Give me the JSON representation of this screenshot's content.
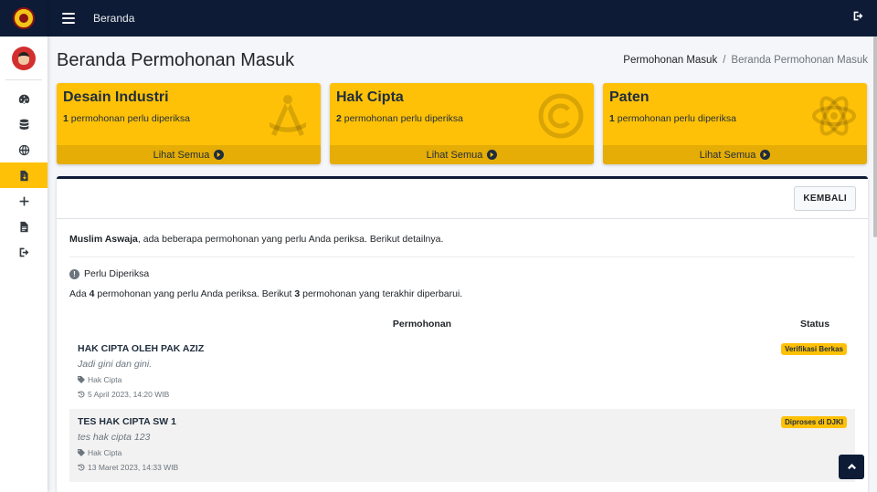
{
  "topbar": {
    "link_label": "Beranda"
  },
  "sidebar": {
    "items": [
      {
        "icon": "dashboard-icon"
      },
      {
        "icon": "database-icon"
      },
      {
        "icon": "globe-icon"
      },
      {
        "icon": "file-download-icon",
        "active": true
      },
      {
        "icon": "plus-icon"
      },
      {
        "icon": "file-icon"
      },
      {
        "icon": "logout-icon"
      }
    ]
  },
  "page": {
    "title": "Beranda Permohonan Masuk"
  },
  "breadcrumb": {
    "parent": "Permohonan Masuk",
    "separator": "/",
    "current": "Beranda Permohonan Masuk"
  },
  "boxes": [
    {
      "title": "Desain Industri",
      "count": "1",
      "desc": "permohonan perlu diperiksa",
      "footer": "Lihat Semua",
      "icon": "compass-icon"
    },
    {
      "title": "Hak Cipta",
      "count": "2",
      "desc": "permohonan perlu diperiksa",
      "footer": "Lihat Semua",
      "icon": "copyright-icon"
    },
    {
      "title": "Paten",
      "count": "1",
      "desc": "permohonan perlu diperiksa",
      "footer": "Lihat Semua",
      "icon": "atom-icon"
    }
  ],
  "card": {
    "back_label": "KEMBALI",
    "intro_name": "Muslim Aswaja",
    "intro_text": ", ada beberapa permohonan yang perlu Anda periksa. Berikut detailnya.",
    "section_title": "Perlu Diperiksa",
    "summary_a": "Ada ",
    "summary_count": "4",
    "summary_b": " permohonan yang perlu Anda periksa. Berikut ",
    "summary_recent": "3",
    "summary_c": " permohonan yang terakhir diperbarui.",
    "col_main": "Permohonan",
    "col_status": "Status",
    "rows": [
      {
        "title": "HAK CIPTA OLEH PAK AZIZ",
        "subtitle": "Jadi gini dan gini.",
        "category": "Hak Cipta",
        "date": "5 April 2023, 14:20 WIB",
        "status": "Verifikasi Berkas"
      },
      {
        "title": "TES HAK CIPTA SW 1",
        "subtitle": "tes hak cipta 123",
        "category": "Hak Cipta",
        "date": "13 Maret 2023, 14:33 WIB",
        "status": "Diproses di DJKI"
      }
    ]
  },
  "colors": {
    "navy": "#0d1b36",
    "warning": "#ffc107"
  }
}
